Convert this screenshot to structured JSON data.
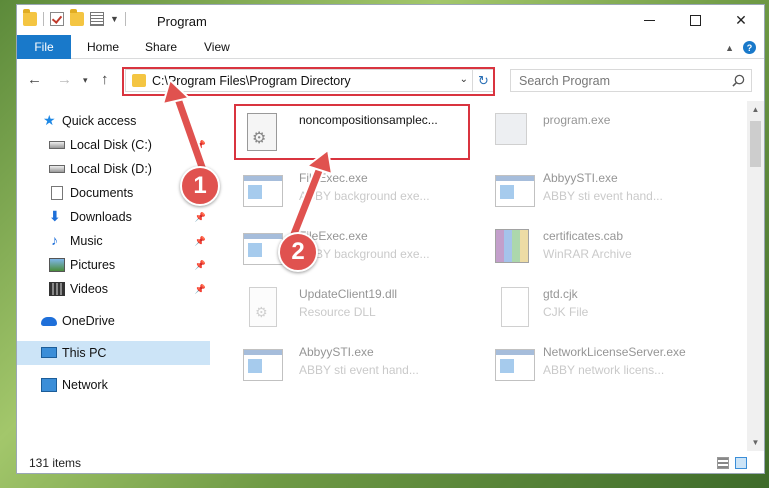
{
  "window": {
    "title": "Program"
  },
  "ribbon": {
    "file": "File",
    "home": "Home",
    "share": "Share",
    "view": "View"
  },
  "address": {
    "path": "C:\\Program Files\\Program Directory"
  },
  "search": {
    "placeholder": "Search Program"
  },
  "sidebar": {
    "items": [
      {
        "label": "Quick access",
        "icon": "star-icon"
      },
      {
        "label": "Local Disk (C:)",
        "icon": "drive-icon",
        "pinned": true
      },
      {
        "label": "Local Disk (D:)",
        "icon": "drive-icon",
        "pinned": true
      },
      {
        "label": "Documents",
        "icon": "documents-icon",
        "pinned": true
      },
      {
        "label": "Downloads",
        "icon": "downloads-icon",
        "pinned": true
      },
      {
        "label": "Music",
        "icon": "music-icon",
        "pinned": true
      },
      {
        "label": "Pictures",
        "icon": "pictures-icon",
        "pinned": true
      },
      {
        "label": "Videos",
        "icon": "videos-icon",
        "pinned": true
      },
      {
        "label": "OneDrive",
        "icon": "onedrive-icon"
      },
      {
        "label": "This PC",
        "icon": "this-pc-icon",
        "selected": true
      },
      {
        "label": "Network",
        "icon": "network-icon"
      }
    ]
  },
  "files": [
    {
      "name": "noncompositionsamplec...",
      "desc": "",
      "icon": "gear-file-icon"
    },
    {
      "name": "program.exe",
      "desc": "",
      "icon": "program-exe-icon"
    },
    {
      "name": "FileExec.exe",
      "desc": "ABBY background exe...",
      "icon": "exe-icon"
    },
    {
      "name": "AbbyySTI.exe",
      "desc": "ABBY sti event hand...",
      "icon": "exe-icon"
    },
    {
      "name": "FileExec.exe",
      "desc": "ABBY background exe...",
      "icon": "exe-icon"
    },
    {
      "name": "certificates.cab",
      "desc": "WinRAR Archive",
      "icon": "winrar-icon"
    },
    {
      "name": "UpdateClient19.dll",
      "desc": "Resource DLL",
      "icon": "dll-icon"
    },
    {
      "name": "gtd.cjk",
      "desc": "CJK File",
      "icon": "cjk-icon"
    },
    {
      "name": "AbbyySTI.exe",
      "desc": "ABBY sti event hand...",
      "icon": "exe-icon"
    },
    {
      "name": "NetworkLicenseServer.exe",
      "desc": "ABBY network licens...",
      "icon": "exe-icon"
    }
  ],
  "status": {
    "count": "131 items"
  },
  "annotations": {
    "step1": "1",
    "step2": "2"
  },
  "colors": {
    "accent": "#1979ca",
    "highlight": "#d9343f",
    "badge": "#e0524f",
    "selected": "#cce4f7"
  }
}
